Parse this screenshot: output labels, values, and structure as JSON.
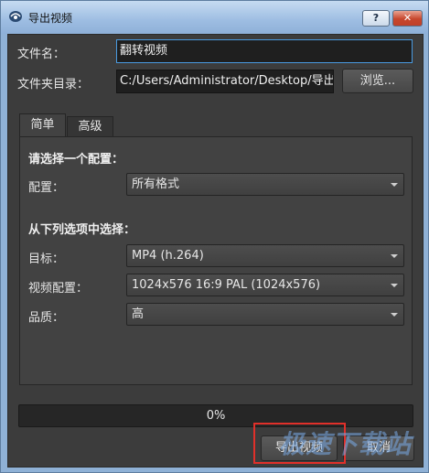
{
  "window": {
    "title": "导出视频",
    "help_label": "?",
    "close_label": "✕"
  },
  "fields": {
    "filename_label": "文件名：",
    "filename_value": "翻转视频",
    "folder_label": "文件夹目录：",
    "folder_value": "C:/Users/Administrator/Desktop/导出",
    "browse_label": "浏览..."
  },
  "tabs": [
    {
      "label": "简单",
      "active": true
    },
    {
      "label": "高级",
      "active": false
    }
  ],
  "simple": {
    "profile_heading": "请选择一个配置：",
    "profile_label": "配置：",
    "profile_value": "所有格式",
    "options_heading": "从下列选项中选择：",
    "target_label": "目标：",
    "target_value": "MP4 (h.264)",
    "video_profile_label": "视频配置：",
    "video_profile_value": "1024x576 16:9 PAL (1024x576)",
    "quality_label": "品质：",
    "quality_value": "高"
  },
  "progress": {
    "value": 0,
    "text": "0%"
  },
  "actions": {
    "export_label": "导出视频",
    "cancel_label": "取消"
  },
  "watermark": {
    "text": "极速下载站"
  },
  "colors": {
    "accent": "#4a9ae0",
    "highlight": "#e0302a",
    "close": "#c7462c"
  }
}
